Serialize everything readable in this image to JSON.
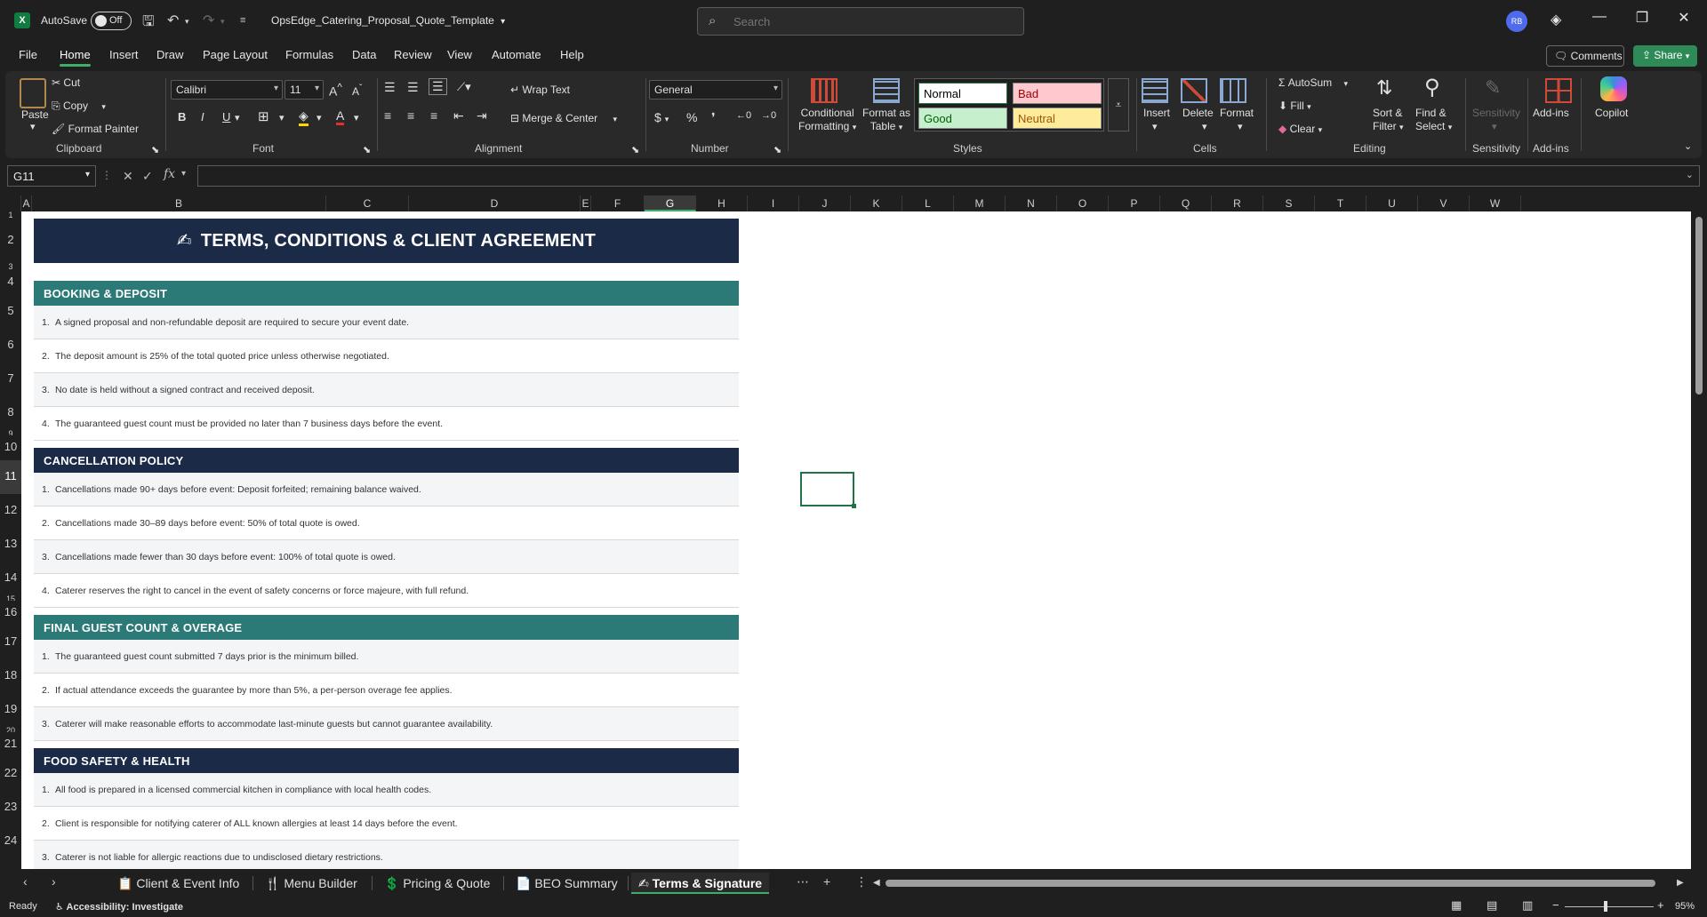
{
  "titlebar": {
    "app_icon": "excel-icon",
    "autosave_label": "AutoSave",
    "autosave_state": "Off",
    "filename": "OpsEdge_Catering_Proposal_Quote_Template",
    "search_placeholder": "Search",
    "avatar_initials": "RB"
  },
  "menu": {
    "items": [
      "File",
      "Home",
      "Insert",
      "Draw",
      "Page Layout",
      "Formulas",
      "Data",
      "Review",
      "View",
      "Automate",
      "Help"
    ],
    "active": "Home",
    "comments_label": "Comments",
    "share_label": "Share"
  },
  "ribbon": {
    "clipboard": {
      "paste": "Paste",
      "cut": "Cut",
      "copy": "Copy",
      "format_painter": "Format Painter",
      "label": "Clipboard"
    },
    "font": {
      "name": "Calibri",
      "size": "11",
      "label": "Font"
    },
    "alignment": {
      "wrap_text": "Wrap Text",
      "merge_center": "Merge & Center",
      "label": "Alignment"
    },
    "number": {
      "format": "General",
      "label": "Number"
    },
    "styles": {
      "conditional_formatting": [
        "Conditional",
        "Formatting"
      ],
      "format_as_table": [
        "Format as",
        "Table"
      ],
      "normal": "Normal",
      "bad": "Bad",
      "good": "Good",
      "neutral": "Neutral",
      "label": "Styles"
    },
    "cells": {
      "insert": "Insert",
      "delete": "Delete",
      "format": "Format",
      "label": "Cells"
    },
    "editing": {
      "autosum": "AutoSum",
      "fill": "Fill",
      "clear": "Clear",
      "sort_filter": [
        "Sort &",
        "Filter"
      ],
      "find_select": [
        "Find &",
        "Select"
      ],
      "label": "Editing"
    },
    "sensitivity": {
      "button": "Sensitivity",
      "label": "Sensitivity"
    },
    "addins": {
      "button": "Add-ins",
      "label": "Add-ins"
    },
    "copilot": "Copilot"
  },
  "formula_bar": {
    "name_box": "G11",
    "fx": "fx",
    "value": ""
  },
  "columns": [
    "A",
    "B",
    "C",
    "D",
    "E",
    "F",
    "G",
    "H",
    "I",
    "J",
    "K",
    "L",
    "M",
    "N",
    "O",
    "P",
    "Q",
    "R",
    "S",
    "T",
    "U",
    "V",
    "W"
  ],
  "selected_column": "G",
  "rows": [
    "1",
    "2",
    "3",
    "4",
    "5",
    "6",
    "7",
    "8",
    "9",
    "10",
    "11",
    "12",
    "13",
    "14",
    "15",
    "16",
    "17",
    "18",
    "19",
    "20",
    "21",
    "22",
    "23",
    "24"
  ],
  "selected_row": "11",
  "document": {
    "title": "TERMS, CONDITIONS & CLIENT AGREEMENT",
    "sections": [
      {
        "heading": "BOOKING & DEPOSIT",
        "items": [
          "A signed proposal and non-refundable deposit are required to secure your event date.",
          "The deposit amount is 25% of the total quoted price unless otherwise negotiated.",
          "No date is held without a signed contract and received deposit.",
          "The guaranteed guest count must be provided no later than 7 business days before the event."
        ]
      },
      {
        "heading": "CANCELLATION POLICY",
        "items": [
          "Cancellations made 90+ days before event: Deposit forfeited; remaining balance waived.",
          "Cancellations made 30–89 days before event: 50% of total quote is owed.",
          "Cancellations made fewer than 30 days before event: 100% of total quote is owed.",
          "Caterer reserves the right to cancel in the event of safety concerns or force majeure, with full refund."
        ]
      },
      {
        "heading": "FINAL GUEST COUNT & OVERAGE",
        "items": [
          "The guaranteed guest count submitted 7 days prior is the minimum billed.",
          "If actual attendance exceeds the guarantee by more than 5%, a per-person overage fee applies.",
          "Caterer will make reasonable efforts to accommodate last-minute guests but cannot guarantee availability."
        ]
      },
      {
        "heading": "FOOD SAFETY & HEALTH",
        "items": [
          "All food is prepared in a licensed commercial kitchen in compliance with local health codes.",
          "Client is responsible for notifying caterer of ALL known allergies at least 14 days before the event.",
          "Caterer is not liable for allergic reactions due to undisclosed dietary restrictions."
        ]
      }
    ]
  },
  "sheet_tabs": [
    "Client & Event Info",
    "Menu Builder",
    "Pricing & Quote",
    "BEO Summary",
    "Terms & Signature"
  ],
  "active_tab": "Terms & Signature",
  "status": {
    "ready": "Ready",
    "accessibility": "Accessibility: Investigate",
    "zoom": "95%"
  },
  "colors": {
    "navy": "#1b2a47",
    "teal": "#2b7a78",
    "accent_green": "#3fae6a"
  }
}
